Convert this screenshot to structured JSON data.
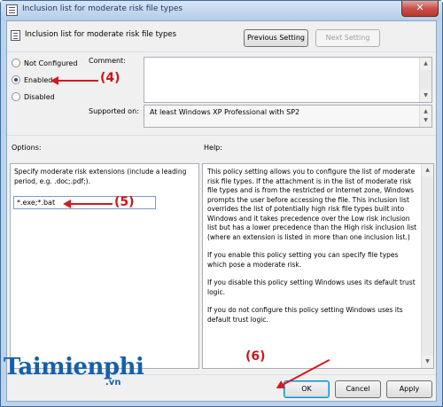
{
  "window": {
    "title": "Inclusion list for moderate risk file types",
    "close_glyph": "✕"
  },
  "header": {
    "title": "Inclusion list for moderate risk file types",
    "prev_button": "Previous Setting",
    "next_button": "Next Setting"
  },
  "state": {
    "options": [
      {
        "label": "Not Configured",
        "checked": false
      },
      {
        "label": "Enabled",
        "checked": true
      },
      {
        "label": "Disabled",
        "checked": false
      }
    ]
  },
  "comment": {
    "label": "Comment:",
    "value": ""
  },
  "supported": {
    "label": "Supported on:",
    "value": "At least Windows XP Professional with SP2"
  },
  "options_panel": {
    "label": "Options:",
    "description": "Specify moderate risk extensions (include a leading period, e.g. .doc;.pdf;).",
    "extensions_value": "*.exe;*.bat"
  },
  "help_panel": {
    "label": "Help:",
    "paragraphs": [
      "This policy setting allows you to configure the list of moderate risk file types. If the attachment is in the list of moderate risk file types and is from the restricted or Internet zone, Windows prompts the user before accessing the file. This inclusion list overrides the list of potentially high risk file types built into Windows and it takes precedence over the Low risk inclusion list but has a lower precedence than the High risk inclusion list (where an extension is listed in more than one inclusion list.)",
      "If you enable this policy setting you can specify file types which pose a moderate risk.",
      "If you disable this policy setting Windows uses its default trust logic.",
      "If you do not configure this policy setting Windows uses its default trust logic."
    ]
  },
  "footer": {
    "ok": "OK",
    "cancel": "Cancel",
    "apply": "Apply"
  },
  "annotations": {
    "step4": "(4)",
    "step5": "(5)",
    "step6": "(6)"
  },
  "watermark": {
    "brand": "Taimienphi",
    "suffix": ".vn"
  },
  "colors": {
    "accent": "#1560ab",
    "annotation": "#d21a1f"
  }
}
